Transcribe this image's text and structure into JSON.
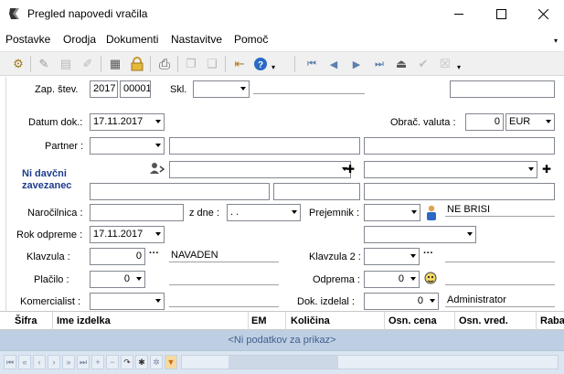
{
  "window": {
    "title": "Pregled napovedi vračila",
    "controls": {
      "minimize": "—",
      "maximize": "☐",
      "close": "✕"
    }
  },
  "menu": [
    {
      "label": "Postavke"
    },
    {
      "label": "Orodja"
    },
    {
      "label": "Dokumenti"
    },
    {
      "label": "Nastavitve"
    },
    {
      "label": "Pomoč"
    }
  ],
  "toolbar": {
    "icons": [
      "tool-icon",
      "new-icon",
      "save-icon",
      "edit-icon",
      "calculator-icon",
      "lock-icon",
      "print-icon",
      "copy-icon",
      "paste-icon",
      "exit-icon",
      "help-icon",
      "first-icon",
      "prev-icon",
      "next-icon",
      "last-icon",
      "eject-icon",
      "check-icon",
      "cancel-icon"
    ],
    "glyphs": {
      "tool": "⚙",
      "new": "✎",
      "save": "▤",
      "edit": "✐",
      "calc": "▦",
      "lock": "🔒",
      "print": "⎙",
      "copy": "❐",
      "paste": "❑",
      "exit": "⇤",
      "help": "?",
      "first": "⏮",
      "prev": "◀",
      "next": "▶",
      "last": "⏭",
      "eject": "⏏",
      "check": "✔",
      "cancel": "☒",
      "more": "▾"
    }
  },
  "form": {
    "zap_stev_label": "Zap. štev.",
    "zap_stev_year": "2017",
    "zap_stev_number": "00001",
    "skl_label": "Skl.",
    "skl_value": "",
    "datum_dok_label": "Datum dok.:",
    "datum_dok_value": "17.11.2017",
    "obrac_valuta_label": "Obrač. valuta :",
    "obrac_valuta_amount": "0",
    "obrac_valuta_currency": "EUR",
    "partner_label": "Partner :",
    "ni_davcni_line1": "Ni davčni",
    "ni_davcni_line2": "zavezanec",
    "narocilnica_label": "Naročilnica :",
    "z_dne_label": "z dne :",
    "z_dne_value": ". .",
    "prejemnik_label": "Prejemnik :",
    "ne_brisi": "NE BRISI",
    "rok_odpreme_label": "Rok odpreme :",
    "rok_odpreme_value": "17.11.2017",
    "klavzula_label": "Klavzula :",
    "klavzula_value": "0",
    "klavzula_text": "NAVADEN",
    "klavzula2_label": "Klavzula 2 :",
    "placilo_label": "Plačilo :",
    "placilo_value": "0",
    "odprema_label": "Odprema :",
    "odprema_value": "0",
    "komercialist_label": "Komercialist :",
    "dok_izdelal_label": "Dok. izdelal :",
    "dok_izdelal_value": "0",
    "dok_izdelal_name": "Administrator",
    "ellipsis": "···",
    "plus": "✚"
  },
  "grid": {
    "columns": [
      "Šifra",
      "Ime izdelka",
      "EM",
      "Količina",
      "Osn. cena",
      "Osn. vred.",
      "Raba"
    ],
    "empty_text": "<Ni podatkov za prikaz>"
  },
  "navigator": {
    "buttons": [
      "⏮",
      "«",
      "‹",
      "›",
      "»",
      "⏭",
      "+",
      "−",
      "✓",
      "✕",
      "↷",
      "✱",
      "✲",
      "▼"
    ]
  }
}
